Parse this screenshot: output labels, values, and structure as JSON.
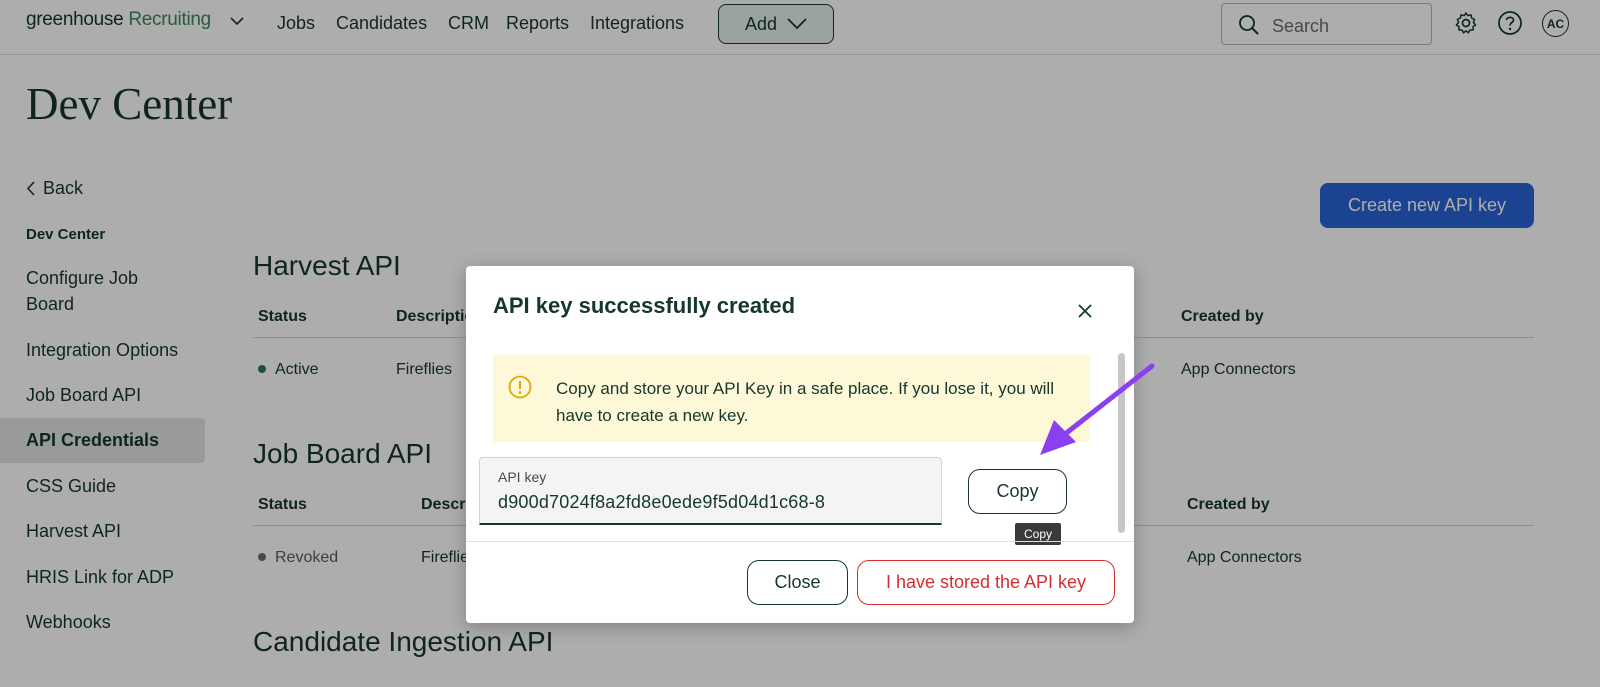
{
  "nav": {
    "logo_main": "greenhouse",
    "logo_sub": "Recruiting",
    "links": [
      "Jobs",
      "Candidates",
      "CRM",
      "Reports",
      "Integrations"
    ],
    "add_label": "Add",
    "search_placeholder": "Search",
    "avatar_initials": "AC"
  },
  "page": {
    "title": "Dev Center",
    "create_button": "Create new API key"
  },
  "sidebar": {
    "back": "Back",
    "heading": "Dev Center",
    "items": [
      {
        "label": "Configure Job Board"
      },
      {
        "label": "Integration Options"
      },
      {
        "label": "Job Board API"
      },
      {
        "label": "API Credentials",
        "active": true
      },
      {
        "label": "CSS Guide"
      },
      {
        "label": "Harvest API"
      },
      {
        "label": "HRIS Link for ADP"
      },
      {
        "label": "Webhooks"
      }
    ]
  },
  "sections": [
    {
      "title": "Harvest API",
      "headers": {
        "status": "Status",
        "description": "Description",
        "created_by": "Created by"
      },
      "row": {
        "status": "Active",
        "description": "Fireflies",
        "created_by": "App Connectors"
      }
    },
    {
      "title": "Job Board API",
      "headers": {
        "status": "Status",
        "description": "Description",
        "created_by": "Created by"
      },
      "row": {
        "status": "Revoked",
        "description": "Fireflies",
        "created_by": "App Connectors"
      }
    },
    {
      "title": "Candidate Ingestion API"
    }
  ],
  "modal": {
    "title": "API key successfully created",
    "alert": "Copy and store your API Key in a safe place. If you lose it, you will have to create a new key.",
    "key_label": "API key",
    "key_value": "d900d7024f8a2fd8e0ede9f5d04d1c68-8",
    "copy_button": "Copy",
    "tooltip": "Copy",
    "close_button": "Close",
    "stored_button": "I have stored the API key"
  },
  "colors": {
    "brand_dark": "#15372c",
    "brand_green": "#3a8a5a",
    "primary_blue": "#2a63d6",
    "danger_red": "#d62e2e",
    "active_dot": "#2f7a4f",
    "revoked_dot": "#6b6b6b",
    "annotation_arrow": "#8a3ff0"
  }
}
